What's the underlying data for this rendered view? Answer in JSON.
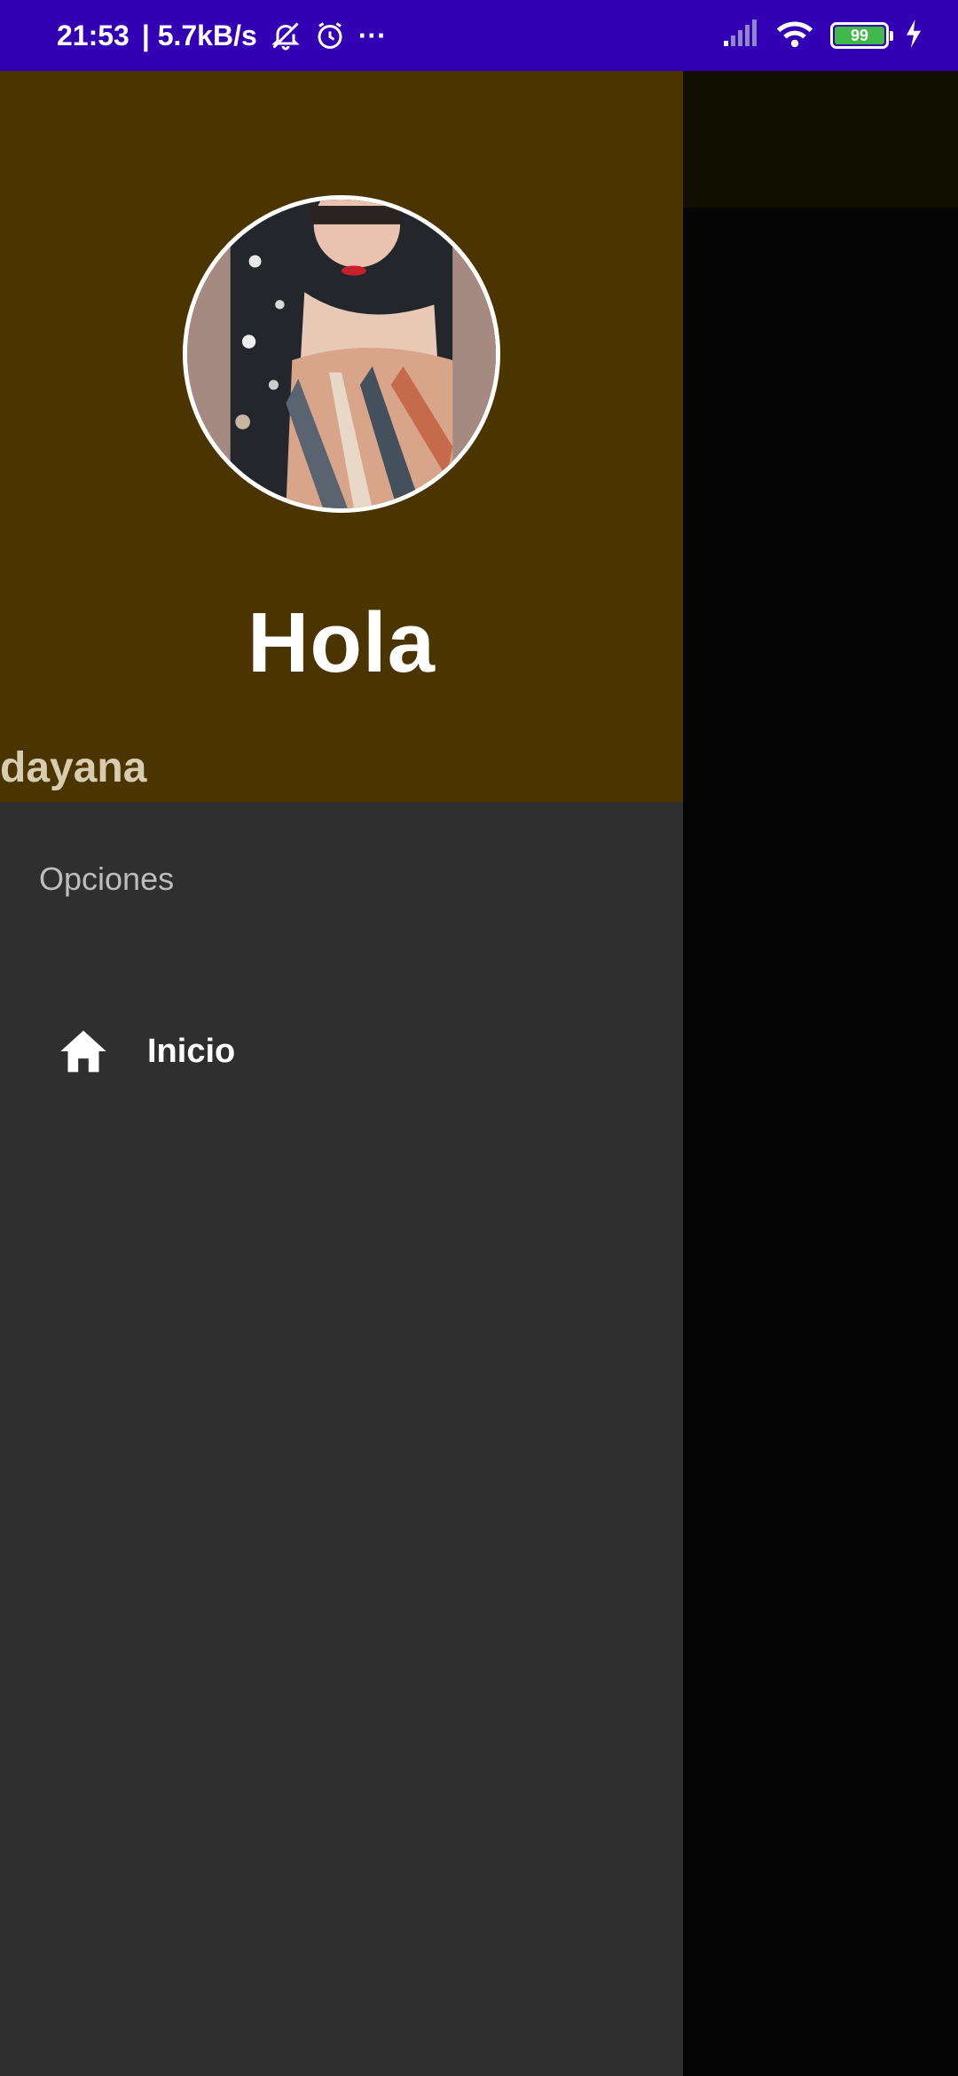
{
  "status_bar": {
    "time": "21:53",
    "network_speed": "| 5.7kB/s",
    "more": "···",
    "battery_level": "99",
    "icons": [
      "mute-bell-icon",
      "alarm-icon",
      "signal-icon",
      "wifi-icon",
      "battery-icon",
      "charging-icon"
    ],
    "color": "#3300b3"
  },
  "drawer": {
    "header": {
      "greeting": "Hola",
      "username": "dayana",
      "background": "#4a3400"
    },
    "section_title": "Opciones",
    "items": [
      {
        "label": "Inicio",
        "icon": "home-icon"
      }
    ],
    "background": "#2f2f2f"
  },
  "scrim": {
    "top_color": "#100f00",
    "body_color": "#050505"
  }
}
